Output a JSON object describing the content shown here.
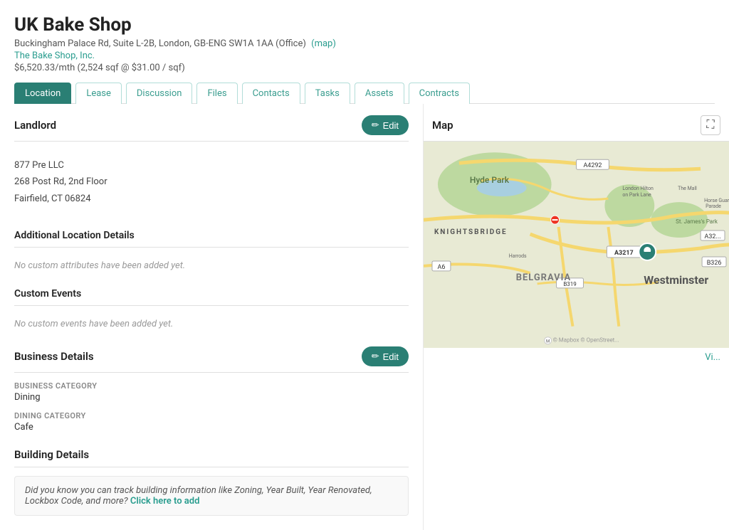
{
  "header": {
    "title": "UK Bake Shop",
    "address": "Buckingham Palace Rd, Suite L-2B, London, GB-ENG SW1A 1AA (Office)",
    "map_link_label": "(map)",
    "company": "The Bake Shop, Inc.",
    "rent": "$6,520.33/mth (2,524 sqf @ $31.00 / sqf)"
  },
  "tabs": [
    {
      "id": "location",
      "label": "Location",
      "active": true
    },
    {
      "id": "lease",
      "label": "Lease",
      "active": false
    },
    {
      "id": "discussion",
      "label": "Discussion",
      "active": false
    },
    {
      "id": "files",
      "label": "Files",
      "active": false
    },
    {
      "id": "contacts",
      "label": "Contacts",
      "active": false
    },
    {
      "id": "tasks",
      "label": "Tasks",
      "active": false
    },
    {
      "id": "assets",
      "label": "Assets",
      "active": false
    },
    {
      "id": "contracts",
      "label": "Contracts",
      "active": false
    }
  ],
  "landlord": {
    "section_title": "Landlord",
    "edit_label": "Edit",
    "name": "877 Pre LLC",
    "address_line1": "268 Post Rd, 2nd Floor",
    "address_line2": "Fairfield, CT 06824"
  },
  "additional_location": {
    "section_title": "Additional Location Details",
    "empty_message": "No custom attributes have been added yet."
  },
  "custom_events": {
    "section_title": "Custom Events",
    "empty_message": "No custom events have been added yet."
  },
  "business_details": {
    "section_title": "Business Details",
    "edit_label": "Edit",
    "fields": [
      {
        "label": "BUSINESS CATEGORY",
        "value": "Dining"
      },
      {
        "label": "DINING CATEGORY",
        "value": "Cafe"
      }
    ]
  },
  "building_details": {
    "section_title": "Building Details",
    "info_text": "Did you know you can track building information like Zoning, Year Built, Year Renovated, Lockbox Code, and more?",
    "click_label": "Click here to add"
  },
  "map": {
    "section_title": "Map",
    "view_link_label": "Vi..."
  },
  "icons": {
    "edit": "✏",
    "expand": "⛶",
    "pencil": "✎"
  }
}
